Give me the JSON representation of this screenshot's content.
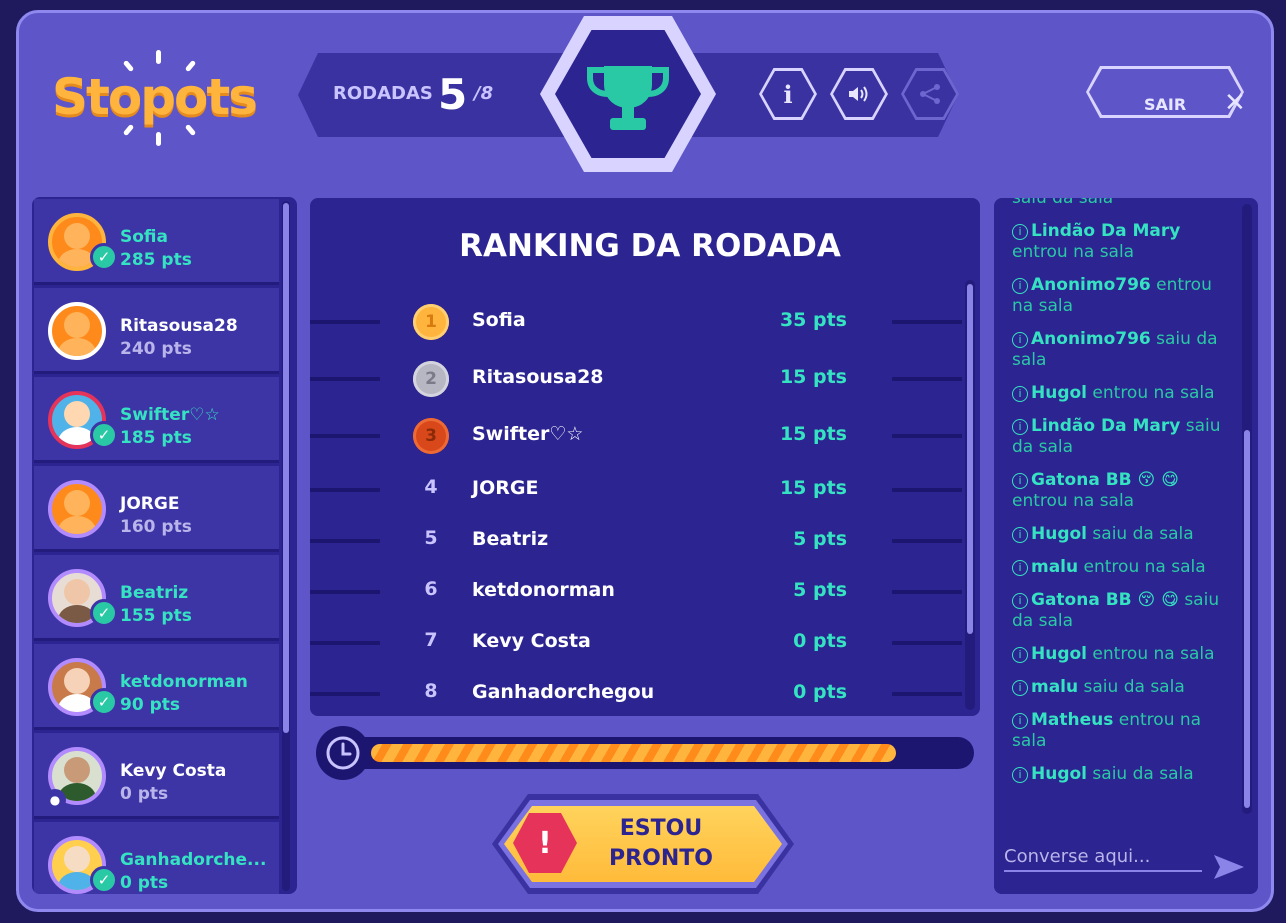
{
  "header": {
    "logo_text": "Stopots",
    "rounds_label": "RODADAS",
    "rounds_current": "5",
    "rounds_total": "/8",
    "buttons": {
      "info_icon": "info-icon",
      "sound_icon": "speaker-icon",
      "share_icon": "share-icon"
    },
    "exit_label": "SAIR",
    "exit_icon": "close-icon"
  },
  "players": [
    {
      "name": "Sofia",
      "points": "285 pts",
      "ready": true
    },
    {
      "name": "Ritasousa28",
      "points": "240 pts",
      "ready": false
    },
    {
      "name": "Swifter♡☆",
      "points": "185 pts",
      "ready": true
    },
    {
      "name": "JORGE",
      "points": "160 pts",
      "ready": false
    },
    {
      "name": "Beatriz",
      "points": "155 pts",
      "ready": true
    },
    {
      "name": "ketdonorman",
      "points": "90 pts",
      "ready": true
    },
    {
      "name": "Kevy Costa",
      "points": "0 pts",
      "ready": false
    },
    {
      "name": "Ganhadorche...",
      "points": "0 pts",
      "ready": true
    }
  ],
  "ranking": {
    "title": "RANKING DA RODADA",
    "rows": [
      {
        "pos": "1",
        "name": "Sofia",
        "points": "35 pts"
      },
      {
        "pos": "2",
        "name": "Ritasousa28",
        "points": "15 pts"
      },
      {
        "pos": "3",
        "name": "Swifter♡☆",
        "points": "15 pts"
      },
      {
        "pos": "4",
        "name": "JORGE",
        "points": "15 pts"
      },
      {
        "pos": "5",
        "name": "Beatriz",
        "points": "5 pts"
      },
      {
        "pos": "6",
        "name": "ketdonorman",
        "points": "5 pts"
      },
      {
        "pos": "7",
        "name": "Kevy Costa",
        "points": "0 pts"
      },
      {
        "pos": "8",
        "name": "Ganhadorchegou",
        "points": "0 pts"
      }
    ]
  },
  "timer": {
    "progress_fraction": 0.87
  },
  "ready_button": {
    "line1": "ESTOU",
    "line2": "PRONTO"
  },
  "chat": {
    "messages": [
      {
        "user": "",
        "text": "saiu da sala"
      },
      {
        "user": "Lindão Da Mary",
        "text": "entrou na sala"
      },
      {
        "user": "Anonimo796",
        "text": "entrou na sala"
      },
      {
        "user": "Anonimo796",
        "text": "saiu da sala"
      },
      {
        "user": "Hugol",
        "text": "entrou na sala"
      },
      {
        "user": "Lindão Da Mary",
        "text": "saiu da sala"
      },
      {
        "user": "Gatona BB 😚 😋",
        "text": "entrou na sala"
      },
      {
        "user": "Hugol",
        "text": "saiu da sala"
      },
      {
        "user": "malu",
        "text": "entrou na sala"
      },
      {
        "user": "Gatona BB 😚 😋",
        "text": "saiu da sala"
      },
      {
        "user": "Hugol",
        "text": "entrou na sala"
      },
      {
        "user": "malu",
        "text": "saiu da sala"
      },
      {
        "user": "Matheus",
        "text": "entrou na sala"
      },
      {
        "user": "Hugol",
        "text": "saiu da sala"
      }
    ],
    "input_placeholder": "Converse aqui..."
  },
  "colors": {
    "background": "#5d55c8",
    "panel": "#2c2490",
    "accent_teal": "#35e3c2",
    "gold": "#ffb43d",
    "silver": "#b7b7c4",
    "bronze": "#d9481a",
    "alert": "#e5335a"
  }
}
